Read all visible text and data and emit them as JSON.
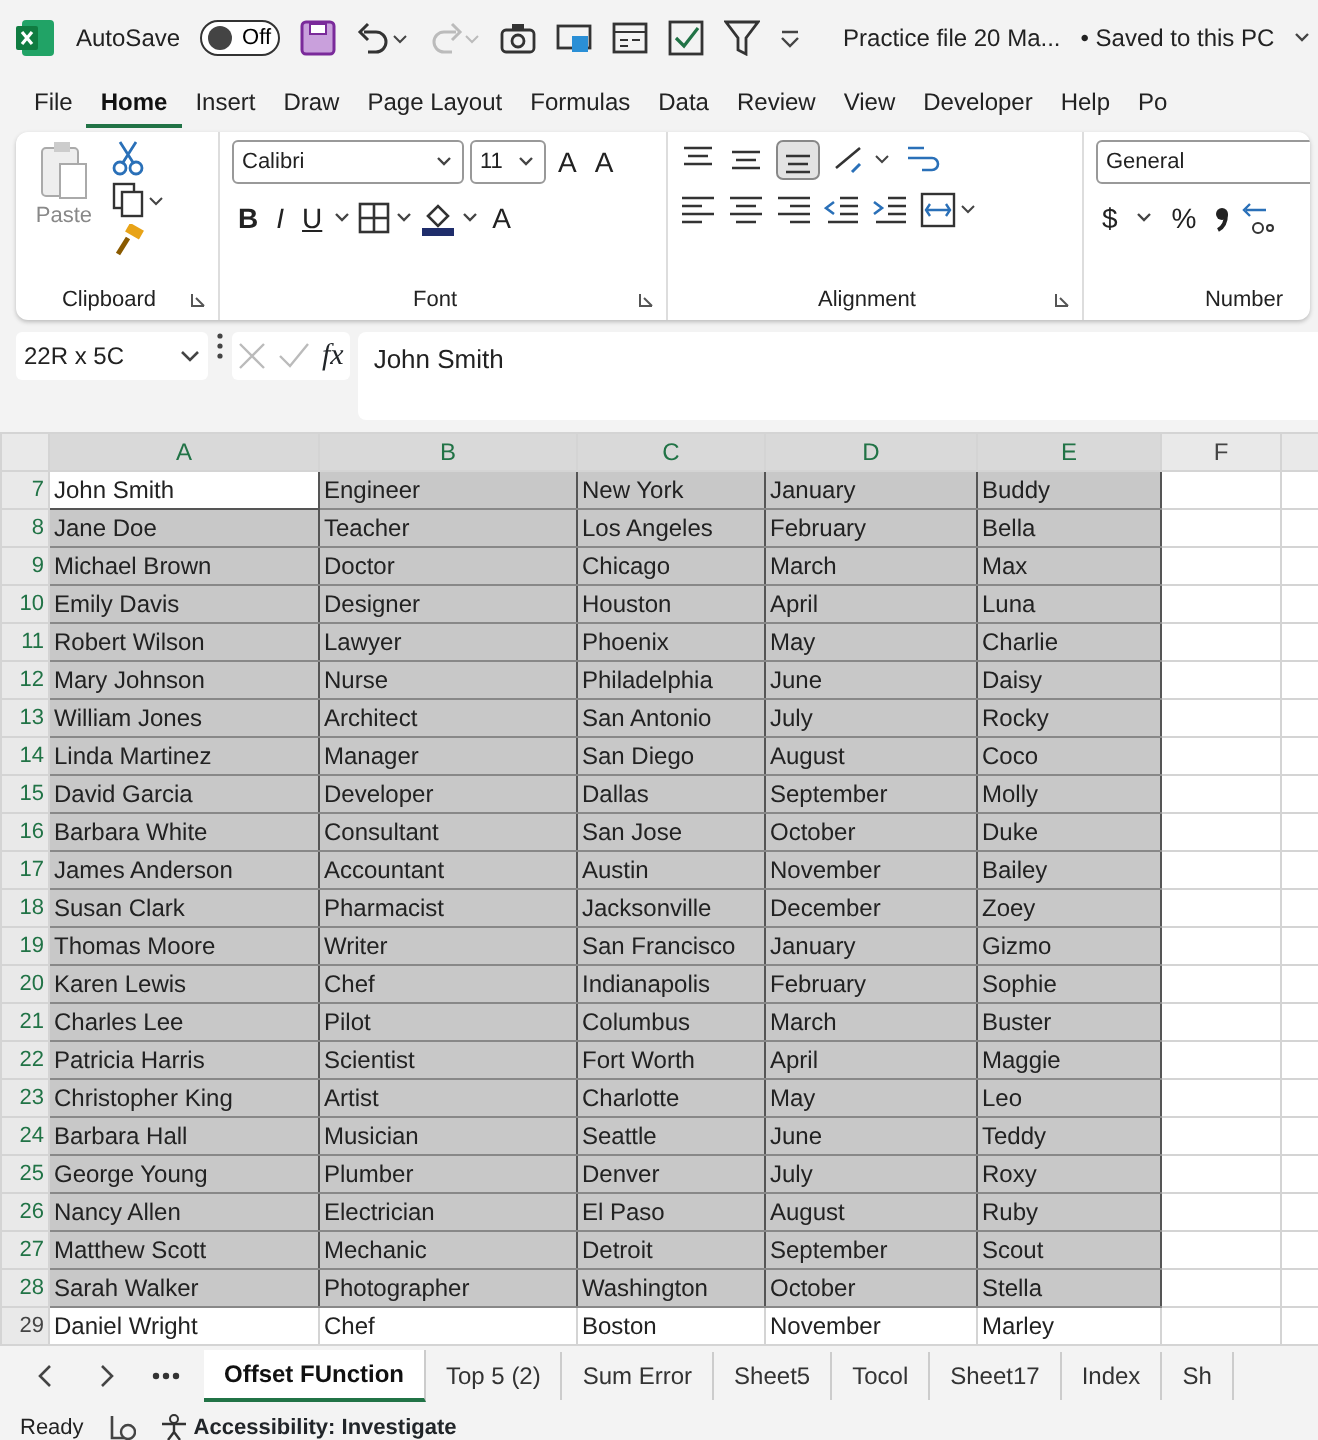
{
  "title_bar": {
    "autosave_label": "AutoSave",
    "autosave": {
      "on": false,
      "label": "Off"
    },
    "file_name": "Practice file 20 Ma...",
    "save_status": "• Saved to this PC"
  },
  "menu_tabs": [
    {
      "label": "File",
      "selected": false
    },
    {
      "label": "Home",
      "selected": true
    },
    {
      "label": "Insert",
      "selected": false
    },
    {
      "label": "Draw",
      "selected": false
    },
    {
      "label": "Page Layout",
      "selected": false
    },
    {
      "label": "Formulas",
      "selected": false
    },
    {
      "label": "Data",
      "selected": false
    },
    {
      "label": "Review",
      "selected": false
    },
    {
      "label": "View",
      "selected": false
    },
    {
      "label": "Developer",
      "selected": false
    },
    {
      "label": "Help",
      "selected": false
    },
    {
      "label": "Po",
      "selected": false
    }
  ],
  "ribbon": {
    "paste_label": "Paste",
    "font_name": "Calibri",
    "font_size": "11",
    "size_buttons": [
      "A",
      "A"
    ],
    "style_buttons": [
      "B",
      "I",
      "U"
    ],
    "font_color_label": "A",
    "number_format": "General",
    "currency": "$",
    "percent": "%",
    "groups": [
      "Clipboard",
      "Font",
      "Alignment",
      "Number"
    ]
  },
  "formula_bar": {
    "name_box": "22R x 5C",
    "fx": "fx",
    "value": "John Smith"
  },
  "columns": [
    "A",
    "B",
    "C",
    "D",
    "E",
    "F"
  ],
  "rows": [
    {
      "num": "7",
      "selected": true,
      "active": true,
      "cells": [
        "John Smith",
        "Engineer",
        "New York",
        "January",
        "Buddy"
      ]
    },
    {
      "num": "8",
      "selected": true,
      "active": false,
      "cells": [
        "Jane Doe",
        "Teacher",
        "Los Angeles",
        "February",
        "Bella"
      ]
    },
    {
      "num": "9",
      "selected": true,
      "active": false,
      "cells": [
        "Michael Brown",
        "Doctor",
        "Chicago",
        "March",
        "Max"
      ]
    },
    {
      "num": "10",
      "selected": true,
      "active": false,
      "cells": [
        "Emily Davis",
        "Designer",
        "Houston",
        "April",
        "Luna"
      ]
    },
    {
      "num": "11",
      "selected": true,
      "active": false,
      "cells": [
        "Robert Wilson",
        "Lawyer",
        "Phoenix",
        "May",
        "Charlie"
      ]
    },
    {
      "num": "12",
      "selected": true,
      "active": false,
      "cells": [
        "Mary Johnson",
        "Nurse",
        "Philadelphia",
        "June",
        "Daisy"
      ]
    },
    {
      "num": "13",
      "selected": true,
      "active": false,
      "cells": [
        "William Jones",
        "Architect",
        "San Antonio",
        "July",
        "Rocky"
      ]
    },
    {
      "num": "14",
      "selected": true,
      "active": false,
      "cells": [
        "Linda Martinez",
        "Manager",
        "San Diego",
        "August",
        "Coco"
      ]
    },
    {
      "num": "15",
      "selected": true,
      "active": false,
      "cells": [
        "David Garcia",
        "Developer",
        "Dallas",
        "September",
        "Molly"
      ]
    },
    {
      "num": "16",
      "selected": true,
      "active": false,
      "cells": [
        "Barbara White",
        "Consultant",
        "San Jose",
        "October",
        "Duke"
      ]
    },
    {
      "num": "17",
      "selected": true,
      "active": false,
      "cells": [
        "James Anderson",
        "Accountant",
        "Austin",
        "November",
        "Bailey"
      ]
    },
    {
      "num": "18",
      "selected": true,
      "active": false,
      "cells": [
        "Susan Clark",
        "Pharmacist",
        "Jacksonville",
        "December",
        "Zoey"
      ]
    },
    {
      "num": "19",
      "selected": true,
      "active": false,
      "cells": [
        "Thomas Moore",
        "Writer",
        "San Francisco",
        "January",
        "Gizmo"
      ]
    },
    {
      "num": "20",
      "selected": true,
      "active": false,
      "cells": [
        "Karen Lewis",
        "Chef",
        "Indianapolis",
        "February",
        "Sophie"
      ]
    },
    {
      "num": "21",
      "selected": true,
      "active": false,
      "cells": [
        "Charles Lee",
        "Pilot",
        "Columbus",
        "March",
        "Buster"
      ]
    },
    {
      "num": "22",
      "selected": true,
      "active": false,
      "cells": [
        "Patricia Harris",
        "Scientist",
        "Fort Worth",
        "April",
        "Maggie"
      ]
    },
    {
      "num": "23",
      "selected": true,
      "active": false,
      "cells": [
        "Christopher King",
        "Artist",
        "Charlotte",
        "May",
        "Leo"
      ]
    },
    {
      "num": "24",
      "selected": true,
      "active": false,
      "cells": [
        "Barbara Hall",
        "Musician",
        "Seattle",
        "June",
        "Teddy"
      ]
    },
    {
      "num": "25",
      "selected": true,
      "active": false,
      "cells": [
        "George Young",
        "Plumber",
        "Denver",
        "July",
        "Roxy"
      ]
    },
    {
      "num": "26",
      "selected": true,
      "active": false,
      "cells": [
        "Nancy Allen",
        "Electrician",
        "El Paso",
        "August",
        "Ruby"
      ]
    },
    {
      "num": "27",
      "selected": true,
      "active": false,
      "cells": [
        "Matthew Scott",
        "Mechanic",
        "Detroit",
        "September",
        "Scout"
      ]
    },
    {
      "num": "28",
      "selected": true,
      "active": false,
      "cells": [
        "Sarah Walker",
        "Photographer",
        "Washington",
        "October",
        "Stella"
      ]
    },
    {
      "num": "29",
      "selected": false,
      "active": false,
      "cells": [
        "Daniel Wright",
        "Chef",
        "Boston",
        "November",
        "Marley"
      ]
    }
  ],
  "sheet_tabs": [
    {
      "label": "Offset FUnction",
      "selected": true
    },
    {
      "label": "Top 5 (2)",
      "selected": false
    },
    {
      "label": "Sum Error",
      "selected": false
    },
    {
      "label": "Sheet5",
      "selected": false
    },
    {
      "label": "Tocol",
      "selected": false
    },
    {
      "label": "Sheet17",
      "selected": false
    },
    {
      "label": "Index",
      "selected": false
    },
    {
      "label": "Sh",
      "selected": false
    }
  ],
  "status_bar": {
    "mode": "Ready",
    "accessibility": "Accessibility: Investigate"
  }
}
